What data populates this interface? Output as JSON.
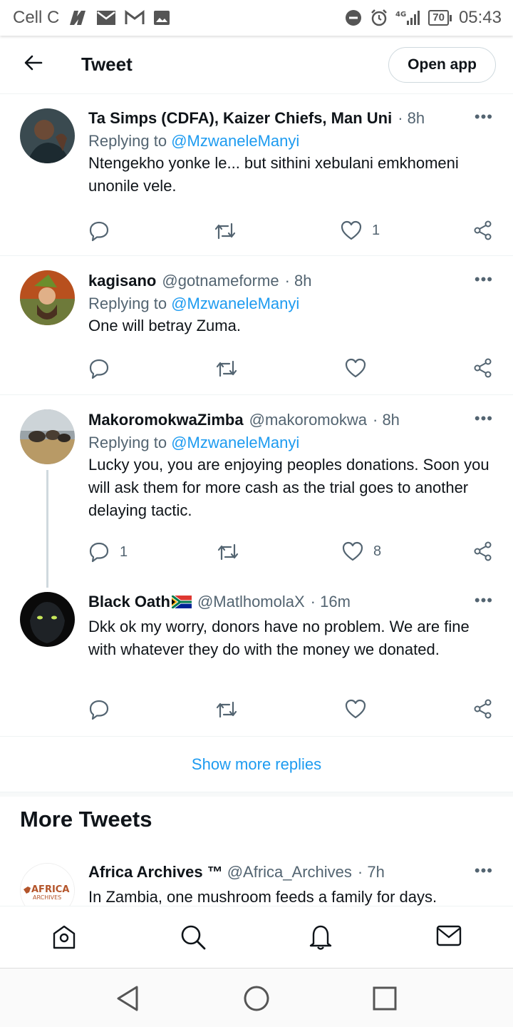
{
  "status_bar": {
    "carrier": "Cell C",
    "time": "05:43",
    "battery": "70",
    "network": "4G"
  },
  "header": {
    "title": "Tweet",
    "open_app_label": "Open app"
  },
  "replying_prefix": "Replying to",
  "tweets": [
    {
      "name": "Ta Simps (CDFA), Kaizer Chiefs, Man Uni",
      "handle": "",
      "time": "· 8h",
      "replying_to": "@MzwaneleManyi",
      "text": "Ntengekho yonke le... but sithini xebulani emkhomeni unonile vele.",
      "replies": "",
      "likes": "1"
    },
    {
      "name": "kagisano",
      "handle": "@gotnameforme",
      "time": "· 8h",
      "replying_to": "@MzwaneleManyi",
      "text": "One will betray Zuma.",
      "replies": "",
      "likes": ""
    },
    {
      "name": "MakoromokwaZimba",
      "handle": "@makoromokwa",
      "time": "· 8h",
      "replying_to": "@MzwaneleManyi",
      "text": "Lucky you, you are enjoying peoples donations. Soon you will ask them for more cash as the trial goes to another delaying tactic.",
      "replies": "1",
      "likes": "8"
    },
    {
      "name": "Black Oath",
      "handle": "@MatlhomolaX",
      "time": "· 16m",
      "replying_to": "",
      "text": "Dkk ok my worry, donors have no problem. We are fine with whatever they do with the money we donated.",
      "replies": "",
      "likes": ""
    }
  ],
  "show_more_replies": "Show more replies",
  "more_tweets": {
    "title": "More Tweets",
    "tweet": {
      "name": "Africa Archives ™",
      "handle": "@Africa_Archives",
      "time": "· 7h",
      "text": "In Zambia, one mushroom feeds a family for days.",
      "avatar_text_top": "AFRICA",
      "avatar_text_bottom": "ARCHIVES"
    }
  },
  "colors": {
    "accent": "#1d9bf0",
    "secondary_text": "#536471",
    "primary_text": "#0f1419"
  },
  "bottom_nav": [
    "home-icon",
    "search-icon",
    "bell-icon",
    "mail-icon"
  ],
  "system_nav": [
    "back-icon",
    "home-circle-icon",
    "recents-icon"
  ]
}
